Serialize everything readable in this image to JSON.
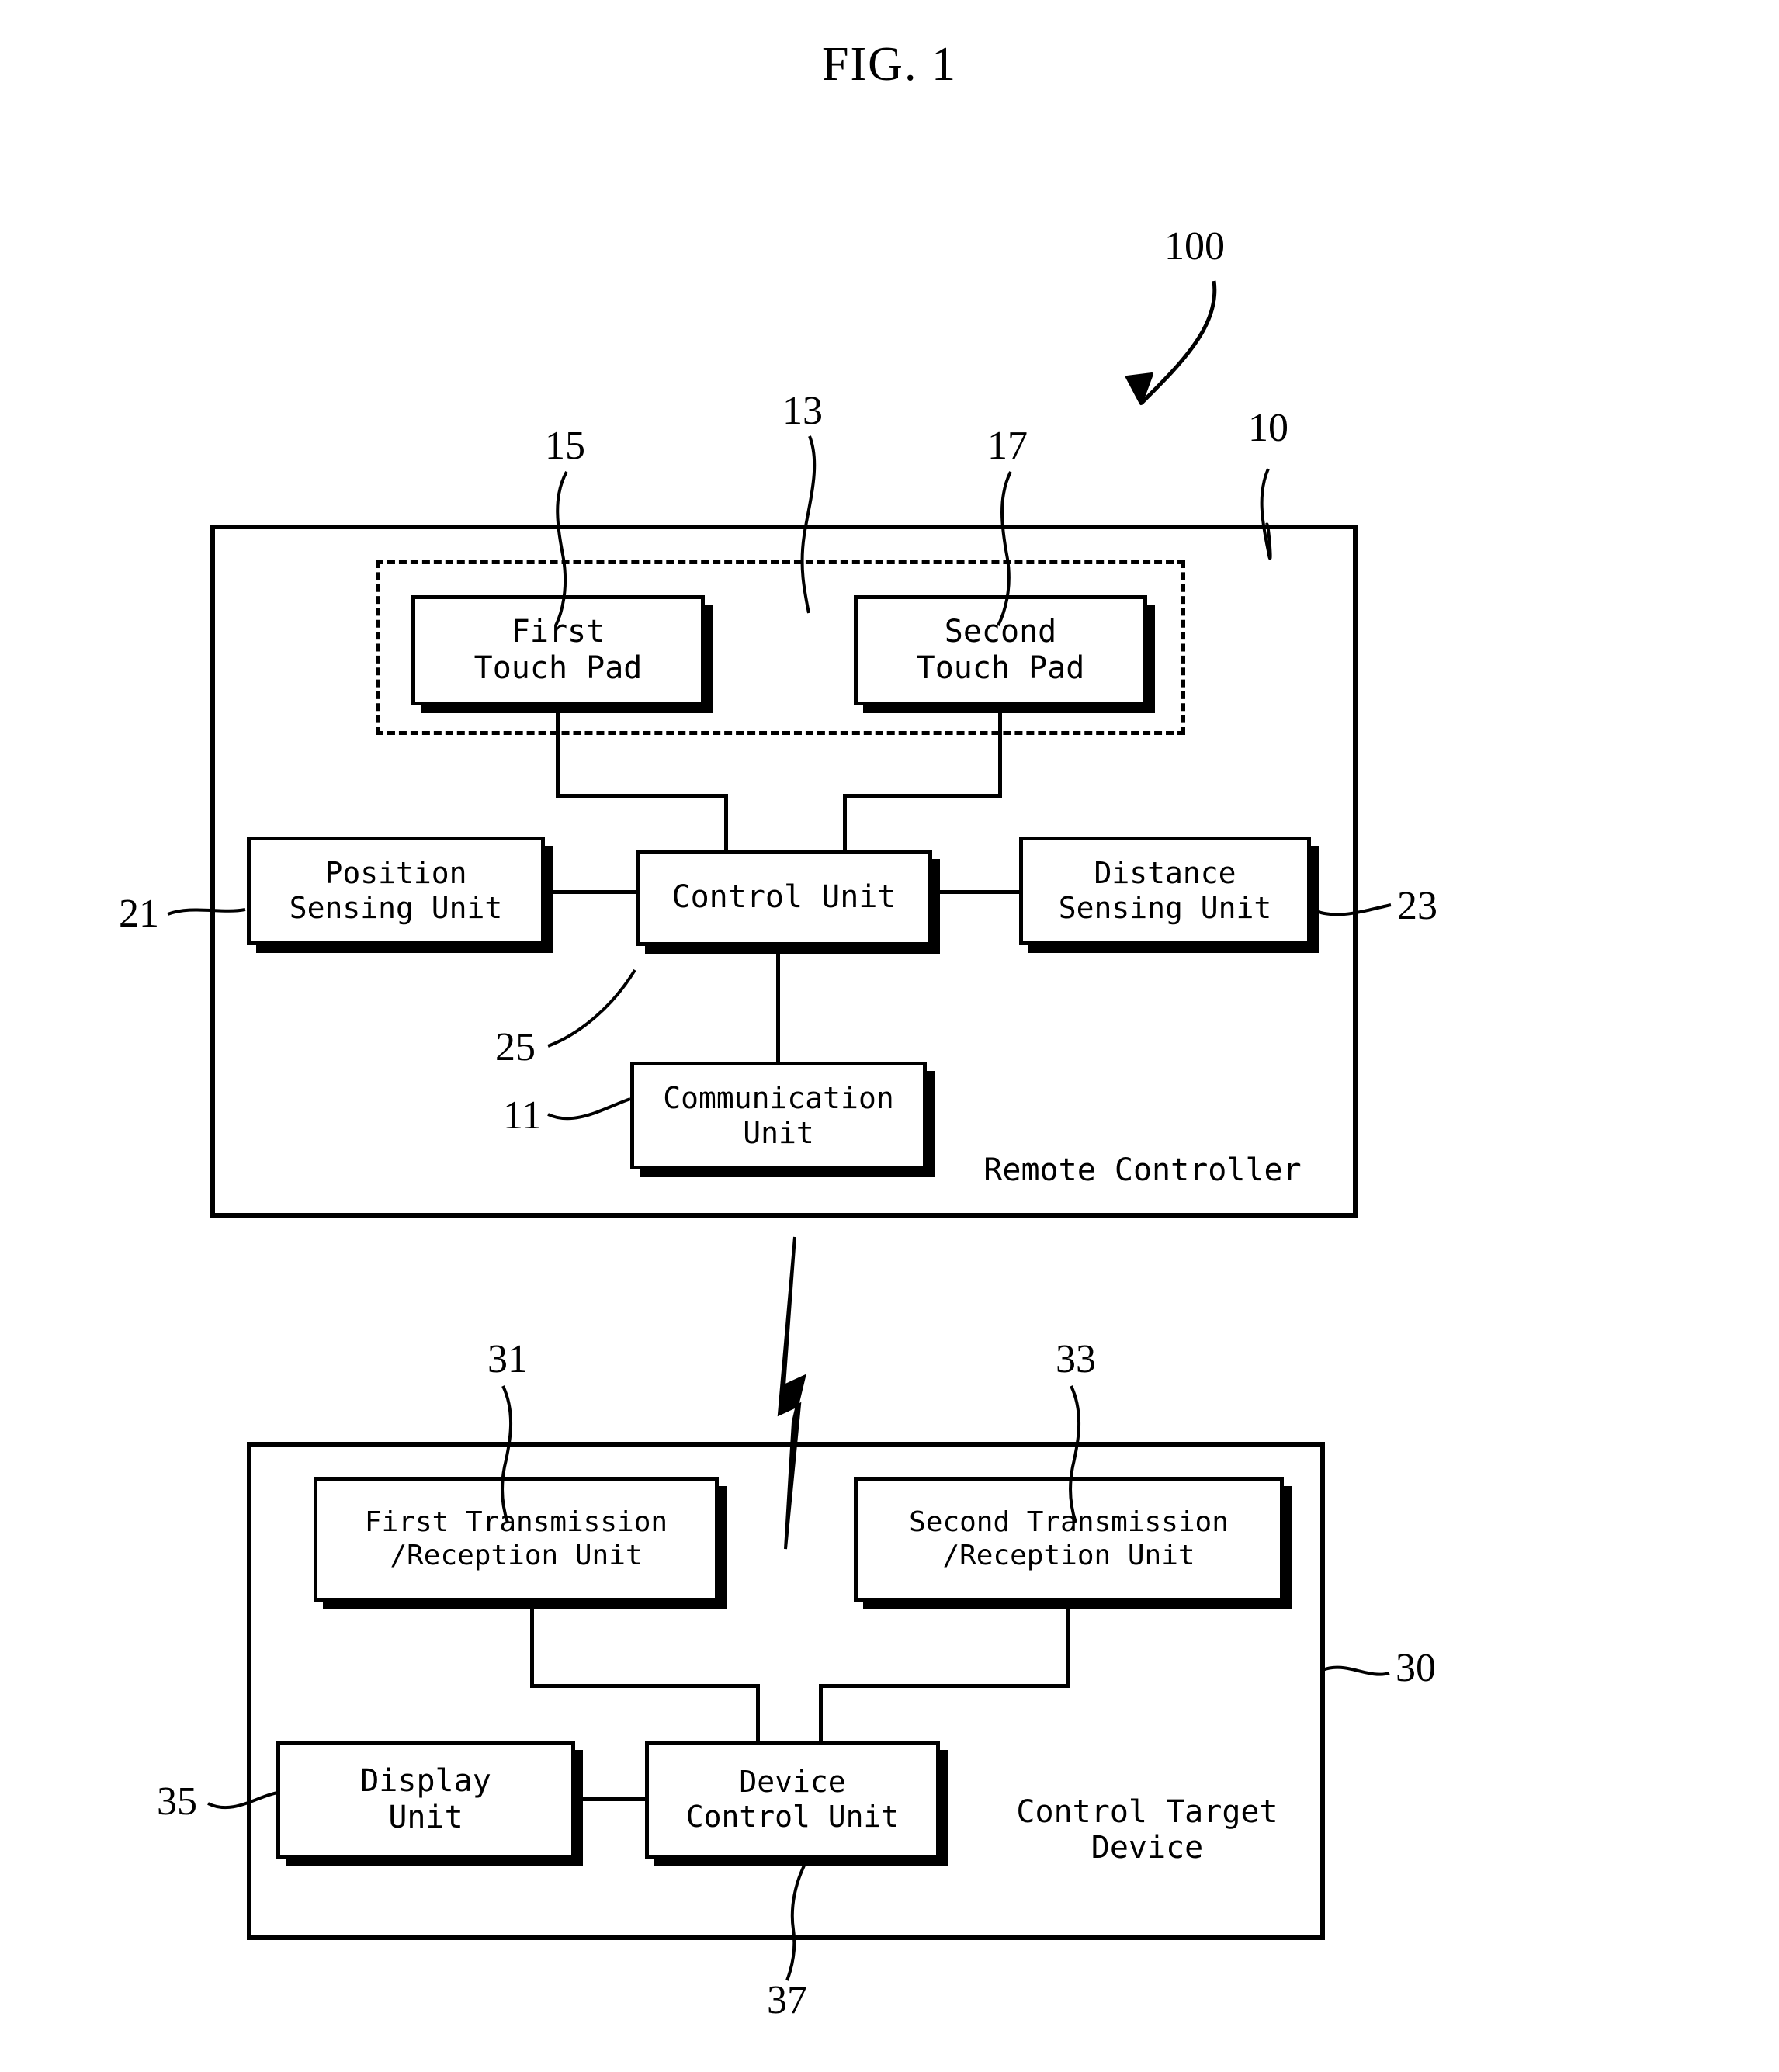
{
  "figure": {
    "title": "FIG. 1"
  },
  "remote_controller": {
    "caption": "Remote Controller",
    "ref": "10",
    "system_ref": "100",
    "touchpad_group_ref": "13",
    "blocks": {
      "first_touch_pad": {
        "label": "First\nTouch Pad",
        "ref": "15"
      },
      "second_touch_pad": {
        "label": "Second\nTouch Pad",
        "ref": "17"
      },
      "position_sensing_unit": {
        "label": "Position\nSensing Unit",
        "ref": "21"
      },
      "control_unit": {
        "label": "Control Unit",
        "ref": "25"
      },
      "distance_sensing_unit": {
        "label": "Distance\nSensing Unit",
        "ref": "23"
      },
      "communication_unit": {
        "label": "Communication\nUnit",
        "ref": "11"
      }
    }
  },
  "control_target_device": {
    "caption": "Control Target\nDevice",
    "ref": "30",
    "blocks": {
      "first_transmission_reception_unit": {
        "label": "First Transmission\n/Reception Unit",
        "ref": "31"
      },
      "second_transmission_reception_unit": {
        "label": "Second Transmission\n/Reception Unit",
        "ref": "33"
      },
      "display_unit": {
        "label": "Display\nUnit",
        "ref": "35"
      },
      "device_control_unit": {
        "label": "Device\nControl Unit",
        "ref": "37"
      }
    }
  },
  "link": {
    "icon": "lightning-bolt-icon"
  },
  "colors": {
    "ink": "#000000",
    "paper": "#ffffff"
  }
}
